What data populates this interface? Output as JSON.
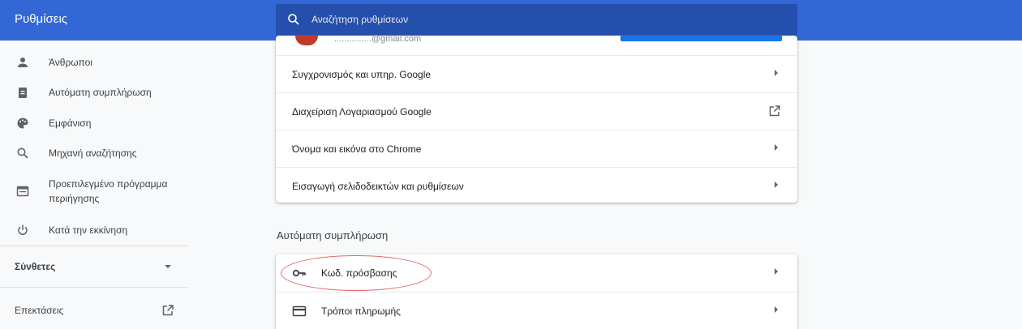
{
  "header": {
    "title": "Ρυθμίσεις",
    "search_placeholder": "Αναζήτηση ρυθμίσεων"
  },
  "sidebar": {
    "items": [
      {
        "label": "Άνθρωποι",
        "icon": "person-icon"
      },
      {
        "label": "Αυτόματη συμπλήρωση",
        "icon": "clipboard-icon"
      },
      {
        "label": "Εμφάνιση",
        "icon": "palette-icon"
      },
      {
        "label": "Μηχανή αναζήτησης",
        "icon": "search-icon"
      },
      {
        "label": "Προεπιλεγμένο πρόγραμμα περιήγησης",
        "icon": "browser-icon"
      },
      {
        "label": "Κατά την εκκίνηση",
        "icon": "power-icon"
      }
    ],
    "advanced": "Σύνθετες",
    "extensions": "Επεκτάσεις"
  },
  "people_card": {
    "email": "...............@gmail.com",
    "rows": [
      {
        "label": "Συγχρονισμός και υπηρ. Google",
        "action": "arrow"
      },
      {
        "label": "Διαχείριση Λογαριασμού Google",
        "action": "external"
      },
      {
        "label": "Όνομα και εικόνα στο Chrome",
        "action": "arrow"
      },
      {
        "label": "Εισαγωγή σελιδοδεικτών και ρυθμίσεων",
        "action": "arrow"
      }
    ]
  },
  "autofill": {
    "title": "Αυτόματη συμπλήρωση",
    "rows": [
      {
        "label": "Κωδ. πρόσβασης",
        "icon": "key-icon"
      },
      {
        "label": "Τρόποι πληρωμής",
        "icon": "credit-card-icon"
      }
    ]
  },
  "colors": {
    "header_blue": "#3367d6",
    "highlight_ellipse": "#e06666"
  }
}
